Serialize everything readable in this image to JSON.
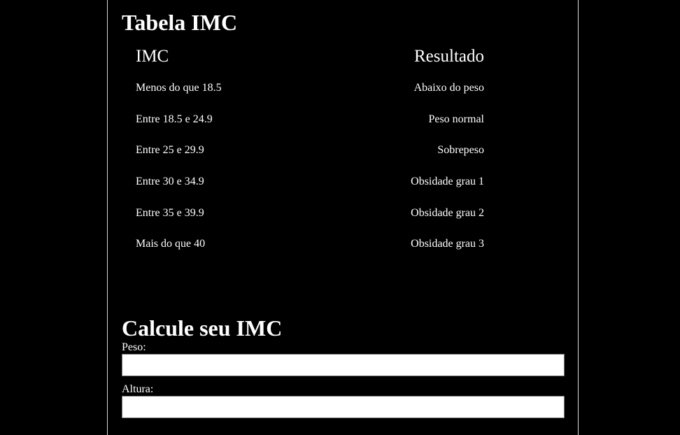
{
  "table_section": {
    "title": "Tabela IMC",
    "headers": {
      "imc": "IMC",
      "result": "Resultado"
    },
    "rows": [
      {
        "range": "Menos do que 18.5",
        "result": "Abaixo do peso"
      },
      {
        "range": "Entre 18.5 e 24.9",
        "result": "Peso normal"
      },
      {
        "range": "Entre 25 e 29.9",
        "result": "Sobrepeso"
      },
      {
        "range": "Entre 30 e 34.9",
        "result": "Obsidade grau 1"
      },
      {
        "range": "Entre 35 e 39.9",
        "result": "Obsidade grau 2"
      },
      {
        "range": "Mais do que 40",
        "result": "Obsidade grau 3"
      }
    ]
  },
  "calc_section": {
    "title": "Calcule seu IMC",
    "peso_label": "Peso:",
    "peso_value": "",
    "altura_label": "Altura:",
    "altura_value": ""
  },
  "colors": {
    "background": "#000000",
    "text": "#ffffff",
    "border": "#d9d9d9",
    "input_background": "#ffffff"
  }
}
